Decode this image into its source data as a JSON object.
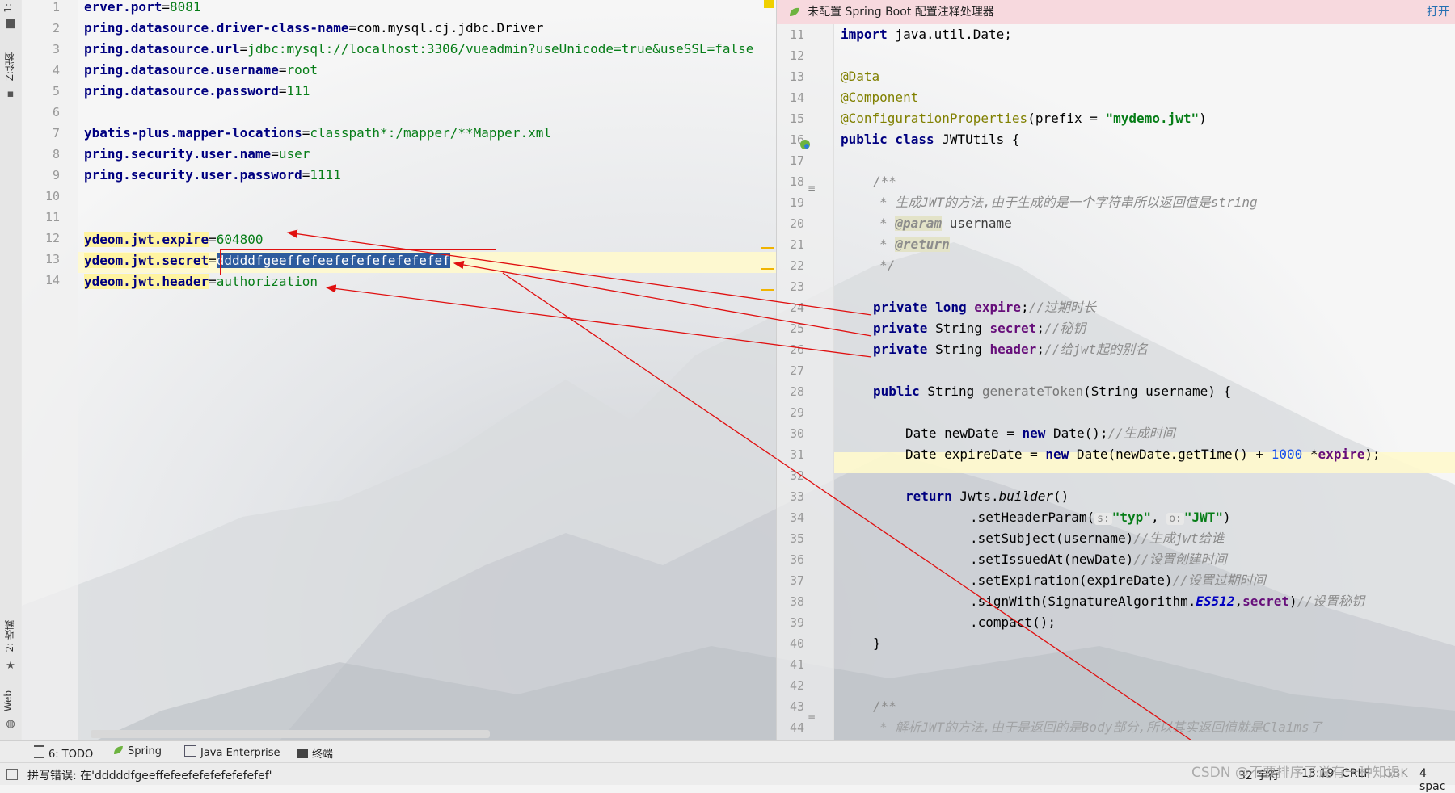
{
  "left_sidebar": {
    "project_label": "1:",
    "structure_label": "Z:结构",
    "favorites_label": "2: 收藏",
    "web_label": "Web"
  },
  "left_editor": {
    "lines": [
      {
        "no": "1",
        "key": "erver.port",
        "eq": "=",
        "val": "8081"
      },
      {
        "no": "2",
        "key": "pring.datasource.driver-class-name",
        "eq": "=",
        "val": "com.mysql.cj.jdbc.Driver"
      },
      {
        "no": "3",
        "key": "pring.datasource.url",
        "eq": "=",
        "val": "jdbc:mysql://localhost:3306/vueadmin?useUnicode=true&useSSL=false"
      },
      {
        "no": "4",
        "key": "pring.datasource.username",
        "eq": "=",
        "val": "root"
      },
      {
        "no": "5",
        "key": "pring.datasource.password",
        "eq": "=",
        "val": "111"
      },
      {
        "no": "6",
        "key": "",
        "eq": "",
        "val": ""
      },
      {
        "no": "7",
        "key": "ybatis-plus.mapper-locations",
        "eq": "=",
        "val": "classpath*:/mapper/**Mapper.xml"
      },
      {
        "no": "8",
        "key": "pring.security.user.name",
        "eq": "=",
        "val": "user"
      },
      {
        "no": "9",
        "key": "pring.security.user.password",
        "eq": "=",
        "val": "1111"
      },
      {
        "no": "10",
        "key": "",
        "eq": "",
        "val": ""
      },
      {
        "no": "11",
        "key": "",
        "eq": "",
        "val": ""
      },
      {
        "no": "12",
        "key": "ydeom.jwt.expire",
        "eq": "=",
        "val": "604800"
      },
      {
        "no": "13",
        "key": "ydeom.jwt.secret",
        "eq": "=",
        "val": "dddddfgeeffefeefefefefefefefef"
      },
      {
        "no": "14",
        "key": "ydeom.jwt.header",
        "eq": "=",
        "val": "authorization"
      }
    ]
  },
  "right_editor": {
    "banner_text": "未配置 Spring Boot 配置注释处理器",
    "banner_link": "打开",
    "line_numbers": [
      "11",
      "12",
      "13",
      "14",
      "15",
      "16",
      "17",
      "18",
      "19",
      "20",
      "21",
      "22",
      "23",
      "24",
      "25",
      "26",
      "27",
      "28",
      "29",
      "30",
      "31",
      "32",
      "33",
      "34",
      "35",
      "36",
      "37",
      "38",
      "39",
      "40",
      "41",
      "42",
      "43",
      "44"
    ],
    "code": {
      "l11_kw": "import",
      "l11_rest": " java.util.Date;",
      "l13": "@Data",
      "l14": "@Component",
      "l15_an": "@ConfigurationProperties",
      "l15_a": "(prefix = ",
      "l15_str": "\"mydemo.jwt\"",
      "l15_b": ")",
      "l16_kw": "public class",
      "l16_rest": " JWTUtils {",
      "l18": "/**",
      "l19": "* 生成JWT的方法,由于生成的是一个字符串所以返回值是string",
      "l20_a": "* ",
      "l20_tag": "@param",
      "l20_b": " username",
      "l21_a": "* ",
      "l21_tag": "@return",
      "l22": "*/",
      "l24_kw": "private long",
      "l24_fd": " expire",
      "l24_s": ";",
      "l24_cm": "//过期时长",
      "l25_kw": "private",
      "l25_t": " String",
      "l25_fd": " secret",
      "l25_s": ";",
      "l25_cm": "//秘钥",
      "l26_kw": "private",
      "l26_t": " String",
      "l26_fd": " header",
      "l26_s": ";",
      "l26_cm": "//给jwt起的别名",
      "l28_kw": "public",
      "l28_t": " String ",
      "l28_m": "generateToken",
      "l28_r": "(String username) {",
      "l30_a": "Date newDate = ",
      "l30_kw": "new",
      "l30_b": " Date();",
      "l30_cm": "//生成时间",
      "l31_a": "Date expireDate = ",
      "l31_kw": "new",
      "l31_b": " Date(newDate.getTime() + ",
      "l31_num": "1000",
      "l31_c": " *",
      "l31_fd": "expire",
      "l31_d": ");",
      "l33_kw": "return",
      "l33_a": " Jwts.",
      "l33_m": "builder",
      "l33_b": "()",
      "l34_a": ".setHeaderParam(",
      "l34_h1": "s:",
      "l34_s1": "\"typ\"",
      "l34_c": ", ",
      "l34_h2": "o:",
      "l34_s2": "\"JWT\"",
      "l34_b": ")",
      "l35_a": ".setSubject(username)",
      "l35_cm": "//生成jwt给谁",
      "l36_a": ".setIssuedAt(newDate)",
      "l36_cm": "//设置创建时间",
      "l37_a": ".setExpiration(expireDate)",
      "l37_cm": "//设置过期时间",
      "l38_a": ".signWith(SignatureAlgorithm.",
      "l38_it": "ES512",
      "l38_c": ",",
      "l38_fd": "secret",
      "l38_b": ")",
      "l38_cm": "//设置秘钥",
      "l39_a": ".compact();",
      "l40": "}",
      "l43": "/**",
      "l44": "* 解析JWT的方法,由于是返回的是Body部分,所以其实返回值就是Claims了"
    }
  },
  "toolbar": {
    "todo": "6: TODO",
    "spring": "Spring",
    "java_enterprise": "Java Enterprise",
    "terminal": "终端"
  },
  "status_bar": {
    "message": "拼写错误: 在'dddddfgeeffefeefefefefefefefef'",
    "chars": "32 字符",
    "position": "13:19",
    "line_sep": "CRLF",
    "encoding": "GBK",
    "indent": "4 spac"
  },
  "watermark": "CSDN @不要排序了说有一种知识"
}
